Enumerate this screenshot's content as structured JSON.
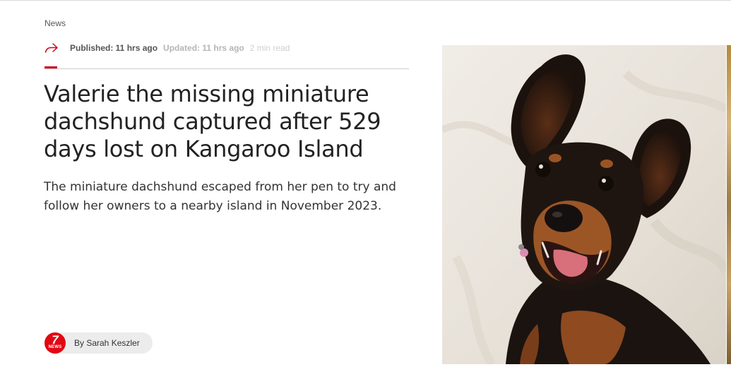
{
  "article": {
    "section": "News",
    "published": "Published: 11 hrs ago",
    "updated": "Updated: 11 hrs ago",
    "read_time": "2 min read",
    "headline": "Valerie the missing miniature dachshund captured after 529 days lost on Kangaroo Island",
    "standfirst": "The miniature dachshund escaped from her pen to try and follow her owners to a nearby island in November 2023.",
    "byline": "By Sarah Keszler"
  },
  "brand": {
    "logo_number": "7",
    "logo_text": "NEWS",
    "accent_color": "#d0021b"
  },
  "icons": {
    "share": "share-icon"
  }
}
